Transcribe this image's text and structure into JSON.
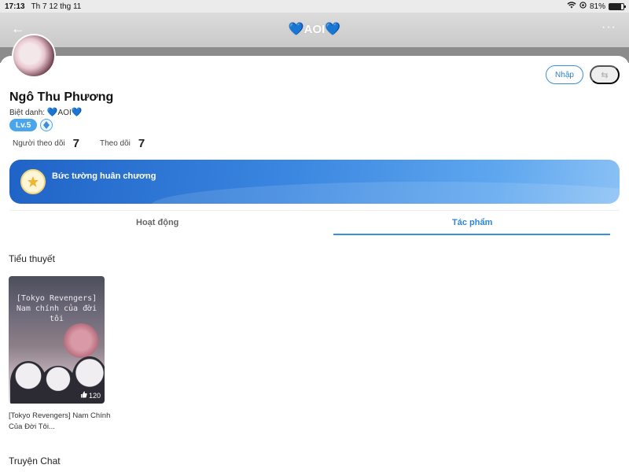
{
  "status_bar": {
    "time": "17:13",
    "date": "Th 7 12 thg 11",
    "battery": "81%",
    "battery_fraction": 0.81
  },
  "nav": {
    "title": "AOI",
    "heart": "💙",
    "back_icon": "←",
    "more_icon": "···"
  },
  "actions": {
    "login_label": "Nhập",
    "share_icon": "⇆"
  },
  "profile": {
    "name": "Ngô Thu Phương",
    "nickname_label": "Biệt danh:",
    "nickname": "AOI",
    "level": "Lv.5",
    "followers_label": "Người theo dõi",
    "followers_count": "7",
    "following_label": "Theo dõi",
    "following_count": "7"
  },
  "medal_wall": {
    "label": "Bức tường huân chương"
  },
  "tabs": [
    {
      "label": "Hoạt động"
    },
    {
      "label": "Tác phẩm"
    }
  ],
  "active_tab": "Tác phẩm",
  "sections": {
    "novels": "Tiểu thuyết",
    "chat": "Truyện Chat"
  },
  "books": [
    {
      "cover_line1": "[Tokyo Revengers]",
      "cover_line2": "Nam chính của đời",
      "cover_line3": "tôi",
      "likes": "120",
      "title": "[Tokyo Revengers] Nam Chính Của Đời Tôi..."
    }
  ],
  "colors": {
    "accent": "#3b8fd9",
    "level_badge": "#4aa6ec",
    "medal_gradient_start": "#1f63c6"
  }
}
